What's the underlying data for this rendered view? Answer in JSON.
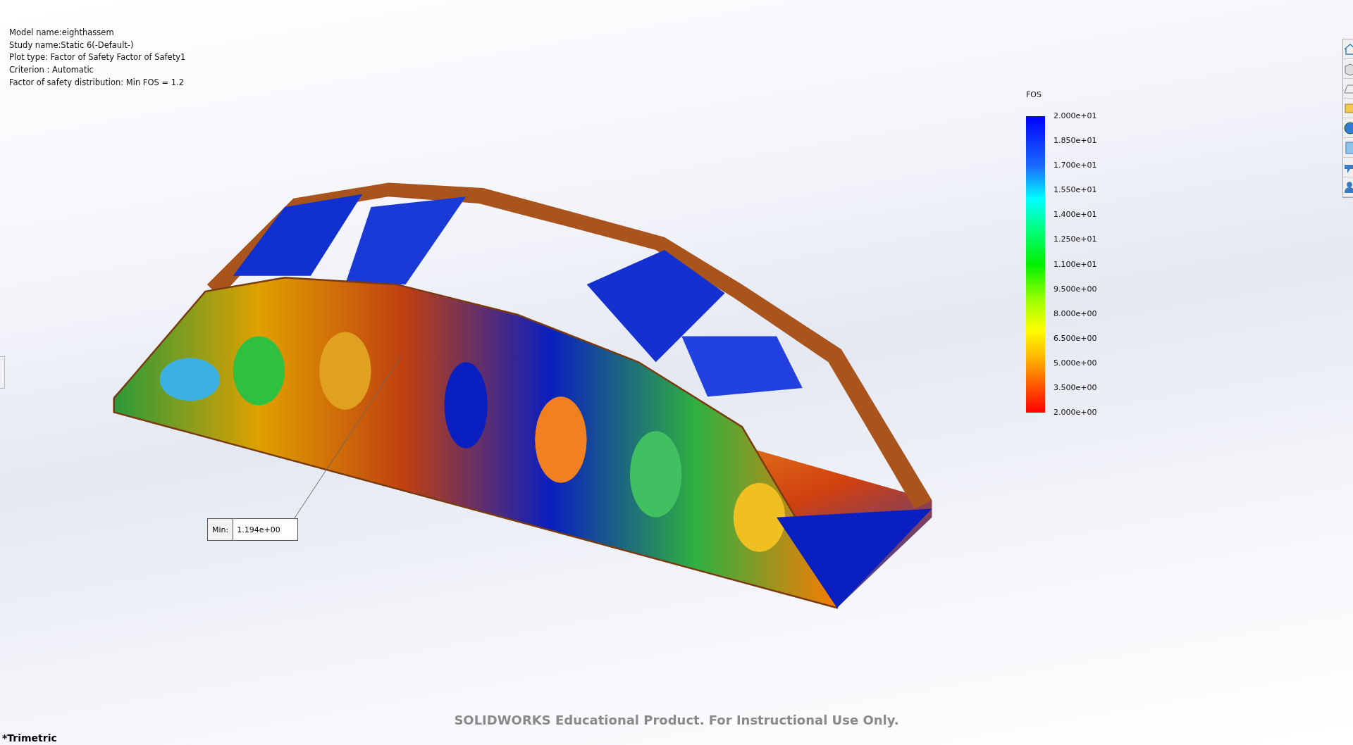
{
  "plot_info": [
    "Model name:eighthassem",
    "Study name:Static 6(-Default-)",
    "Plot type: Factor of Safety Factor of Safety1",
    "Criterion : Automatic",
    "Factor of safety distribution: Min FOS = 1.2"
  ],
  "legend": {
    "title": "FOS",
    "labels": [
      "2.000e+01",
      "1.850e+01",
      "1.700e+01",
      "1.550e+01",
      "1.400e+01",
      "1.250e+01",
      "1.100e+01",
      "9.500e+00",
      "8.000e+00",
      "6.500e+00",
      "5.000e+00",
      "3.500e+00",
      "2.000e+00"
    ]
  },
  "min_probe": {
    "label": "Min:",
    "value": "1.194e+00"
  },
  "notice": "SOLIDWORKS Educational Product. For Instructional Use Only.",
  "view_orientation": "*Trimetric"
}
